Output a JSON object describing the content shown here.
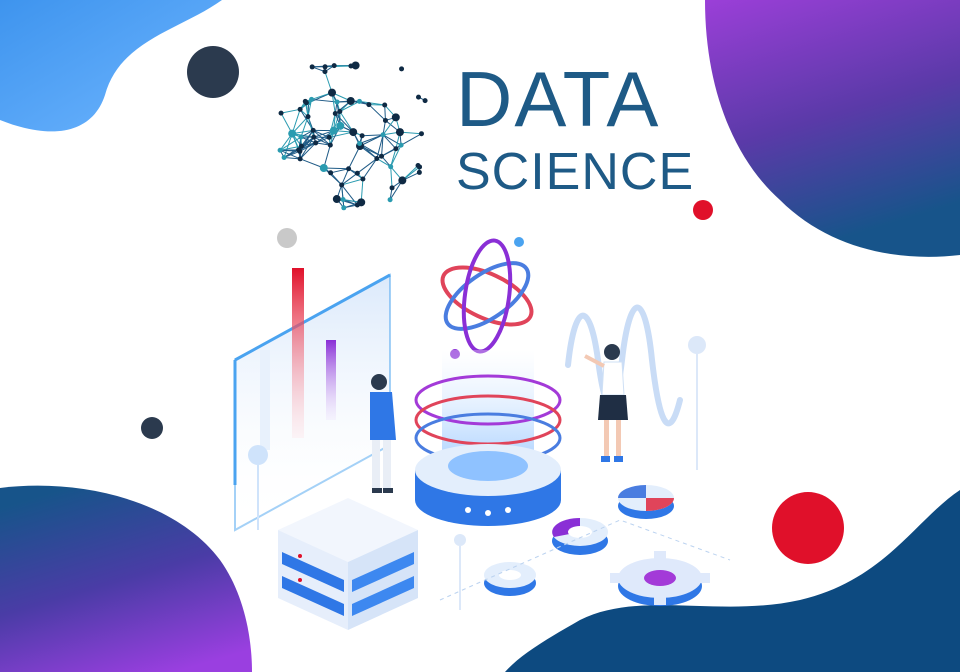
{
  "logo": {
    "line1": "DATA",
    "line2": "SCIENCE"
  },
  "colors": {
    "brand_blue": "#1e5a86",
    "navy": "#0d4a80",
    "purple": "#8a2fd6",
    "red": "#e0102a",
    "light_blue": "#4aa3f0",
    "dark_dot": "#2b3a4e"
  },
  "illustration": {
    "subject": "data-science-isometric-scene",
    "elements": [
      "bar-chart-panel",
      "atom-icon",
      "hologram-platform",
      "server-rack",
      "pie-charts",
      "gear",
      "sine-wave",
      "person-man",
      "person-woman",
      "network-globe"
    ]
  }
}
